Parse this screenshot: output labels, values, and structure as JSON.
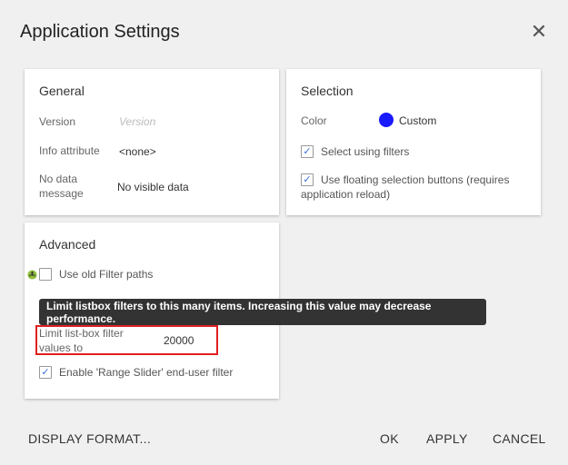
{
  "dialog": {
    "title": "Application Settings"
  },
  "general": {
    "title": "General",
    "version_label": "Version",
    "version_placeholder": "Version",
    "info_attr_label": "Info attribute",
    "info_attr_value": "<none>",
    "no_data_label_1": "No data",
    "no_data_label_2": "message",
    "no_data_value": "No visible data"
  },
  "selection": {
    "title": "Selection",
    "color_label": "Color",
    "color_value": "Custom",
    "color_swatch": "#1a1aff",
    "select_filters_label": "Select using filters",
    "floating_label_1": "Use floating selection buttons (requires",
    "floating_label_2": "application reload)"
  },
  "advanced": {
    "title": "Advanced",
    "old_filter_label": "Use old Filter paths",
    "tooltip": "Limit listbox filters to this many items. Increasing this value may decrease performance.",
    "limit_label_1": "Limit list-box filter",
    "limit_label_2": "values to",
    "limit_value": "20000",
    "range_slider_label": "Enable 'Range Slider' end-user filter"
  },
  "footer": {
    "display_format": "DISPLAY FORMAT...",
    "ok": "OK",
    "apply": "APPLY",
    "cancel": "CANCEL"
  }
}
